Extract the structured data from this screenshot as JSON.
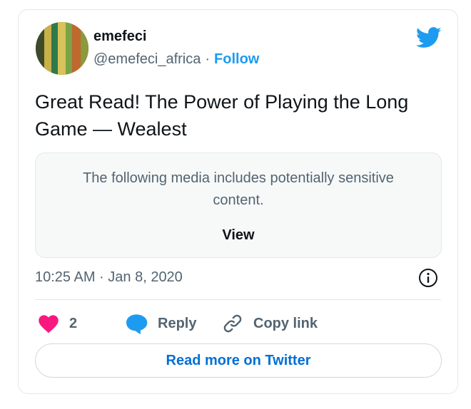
{
  "author": {
    "name": "emefeci",
    "handle": "@emefeci_africa",
    "separator": "·",
    "follow_label": "Follow"
  },
  "tweet": {
    "text": "Great Read! The Power of Playing the Long Game — Wealest"
  },
  "media_warning": {
    "message": "The following media includes potentially sensitive content.",
    "view_label": "View"
  },
  "timestamp": "10:25 AM · Jan 8, 2020",
  "actions": {
    "like_count": "2",
    "reply_label": "Reply",
    "copy_link_label": "Copy link"
  },
  "read_more_label": "Read more on Twitter",
  "colors": {
    "brand_blue": "#1d9bf0",
    "link_blue": "#006fd6",
    "heart_pink": "#f91880",
    "reply_blue": "#1d9bf0",
    "secondary_text": "#536471"
  },
  "icons": [
    "twitter-bird-icon",
    "info-icon",
    "heart-icon",
    "reply-bubble-icon",
    "link-icon"
  ]
}
